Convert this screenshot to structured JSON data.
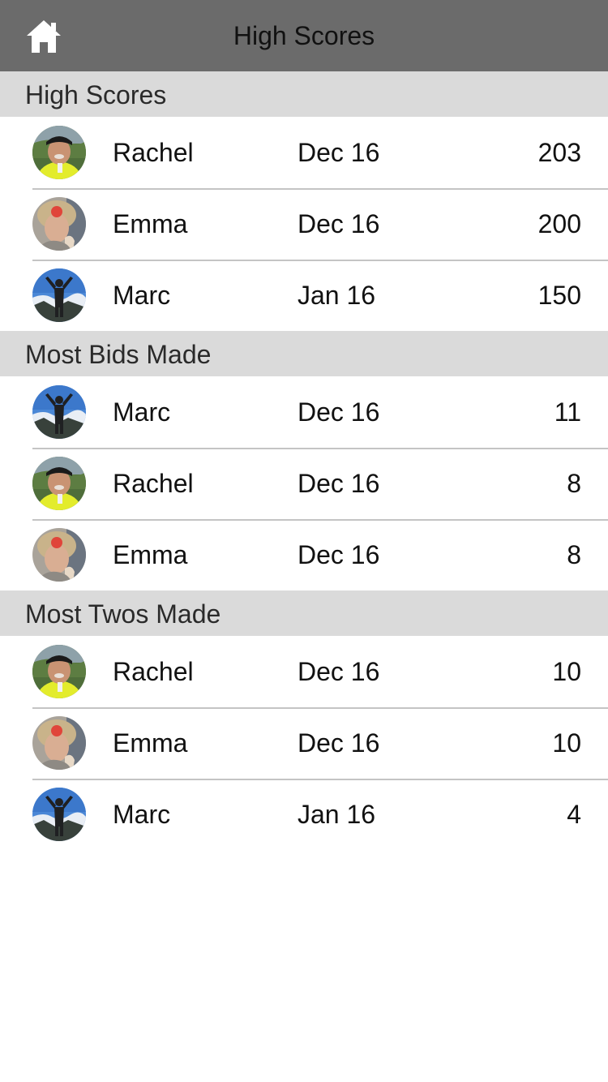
{
  "header": {
    "title": "High Scores",
    "home_icon": "home-icon"
  },
  "colors": {
    "navbar_bg": "#6b6b6b",
    "section_header_bg": "#dadada",
    "separator": "#c4c4c4"
  },
  "sections": [
    {
      "title": "High Scores",
      "rows": [
        {
          "name": "Rachel",
          "date": "Dec 16",
          "value": "203",
          "avatar": "rachel-avatar"
        },
        {
          "name": "Emma",
          "date": "Dec 16",
          "value": "200",
          "avatar": "emma-avatar"
        },
        {
          "name": "Marc",
          "date": "Jan 16",
          "value": "150",
          "avatar": "marc-avatar"
        }
      ]
    },
    {
      "title": "Most Bids Made",
      "rows": [
        {
          "name": "Marc",
          "date": "Dec 16",
          "value": "11",
          "avatar": "marc-avatar"
        },
        {
          "name": "Rachel",
          "date": "Dec 16",
          "value": "8",
          "avatar": "rachel-avatar"
        },
        {
          "name": "Emma",
          "date": "Dec 16",
          "value": "8",
          "avatar": "emma-avatar"
        }
      ]
    },
    {
      "title": "Most Twos Made",
      "rows": [
        {
          "name": "Rachel",
          "date": "Dec 16",
          "value": "10",
          "avatar": "rachel-avatar"
        },
        {
          "name": "Emma",
          "date": "Dec 16",
          "value": "10",
          "avatar": "emma-avatar"
        },
        {
          "name": "Marc",
          "date": "Jan 16",
          "value": "4",
          "avatar": "marc-avatar"
        }
      ]
    }
  ]
}
